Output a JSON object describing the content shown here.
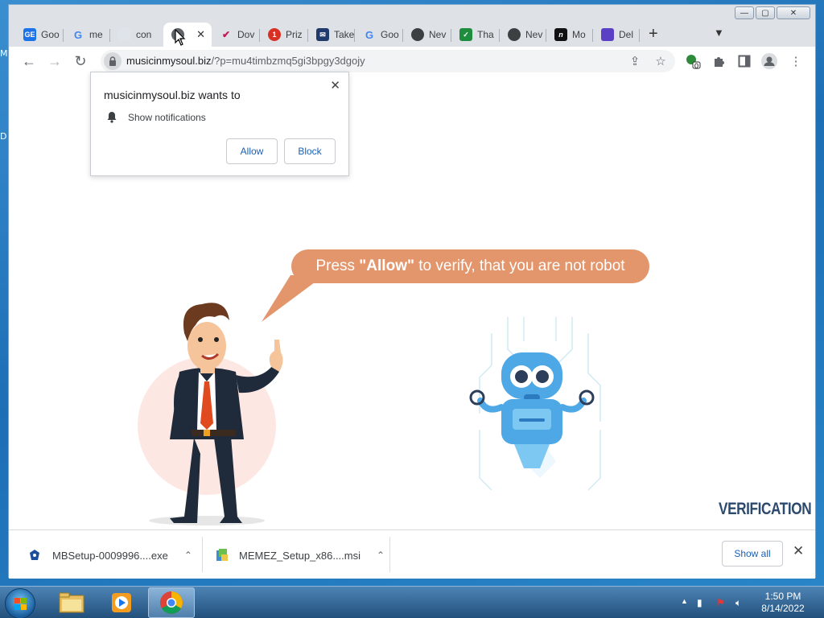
{
  "desktop": {
    "left_letters": [
      "M",
      "D"
    ]
  },
  "window": {
    "caption": {
      "minimize": "—",
      "maximize": "▢",
      "close": "✕"
    }
  },
  "tabs": [
    {
      "label": "Goo",
      "favicon": "GE",
      "color": "#1a73e8"
    },
    {
      "label": "me",
      "favicon": "G",
      "color": "#ffffff"
    },
    {
      "label": "con",
      "favicon": "",
      "color": "#dfe3ea"
    },
    {
      "label": "",
      "favicon": "",
      "color": "#5f6368",
      "active": true
    },
    {
      "label": "Dov",
      "favicon": "✔",
      "color": "#c2185b"
    },
    {
      "label": "Priz",
      "favicon": "1",
      "color": "#d93025"
    },
    {
      "label": "Take",
      "favicon": "✉",
      "color": "#1f3a6b"
    },
    {
      "label": "Goo",
      "favicon": "G",
      "color": "#ffffff"
    },
    {
      "label": "Nev",
      "favicon": "",
      "color": "#3c4043"
    },
    {
      "label": "Tha",
      "favicon": "✓",
      "color": "#1e8e3e"
    },
    {
      "label": "Nev",
      "favicon": "",
      "color": "#3c4043"
    },
    {
      "label": "Mo",
      "favicon": "n",
      "color": "#111111"
    },
    {
      "label": "Del",
      "favicon": "",
      "color": "#5b3fc4"
    }
  ],
  "toolbar": {
    "url_host": "musicinmysoul.biz",
    "url_path": "/?p=mu4timbzmq5gi3bpgy3dgojy",
    "extension_badge": "0"
  },
  "permission_prompt": {
    "title": "musicinmysoul.biz wants to",
    "item": "Show notifications",
    "allow": "Allow",
    "block": "Block",
    "close": "✕"
  },
  "page": {
    "bubble_prefix": "Press ",
    "bubble_bold": "\"Allow\"",
    "bubble_suffix": " to verify, that you are not robot",
    "verification": "VERIFICATION"
  },
  "downloads": {
    "items": [
      {
        "name": "MBSetup-0009996....exe"
      },
      {
        "name": "MEMEZ_Setup_x86....msi"
      }
    ],
    "show_all": "Show all",
    "close": "✕"
  },
  "taskbar": {
    "time": "1:50 PM",
    "date": "8/14/2022"
  }
}
